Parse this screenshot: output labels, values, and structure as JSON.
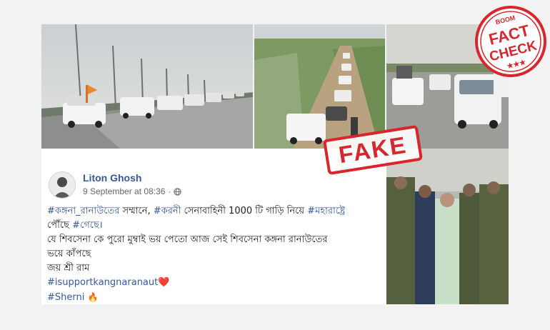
{
  "post": {
    "author": "Liton Ghosh",
    "timestamp": "9 September at 08:36",
    "separator": "·",
    "lines": [
      {
        "t1": "#কঙ্গনা_রানাউতের",
        "t2": " সম্মানে, ",
        "t3": "#করনী",
        "t4": " সেনাবাহিনী 1000 টি গাড়ি নিয়ে ",
        "t5": "#মহারাষ্ট্রে"
      },
      {
        "t1": "পৌঁছে ",
        "t2": "#গেছে",
        "t3": "।"
      },
      {
        "t1": "যে শিবসেনা কে পুরো মুম্বাই ভয় পেতো আজ সেই শিবসেনা কঙ্গনা রানাউতের"
      },
      {
        "t1": "ভয়ে কাঁপছে"
      },
      {
        "t1": "জয় শ্রী রাম"
      },
      {
        "t1": "#isupportkangnaranaut",
        "emoji": "❤️"
      },
      {
        "t1": "#Sherni",
        "emoji": "🔥"
      }
    ]
  },
  "stamp": {
    "text": "FAKE",
    "color": "#d7262e"
  },
  "badge": {
    "brand": "BOOM",
    "line1": "FACT",
    "line2": "CHECK",
    "stars": "★★★",
    "color": "#d7262e"
  },
  "icons": {
    "globe": "globe-icon",
    "heart": "heart-icon",
    "fire": "fire-icon"
  }
}
